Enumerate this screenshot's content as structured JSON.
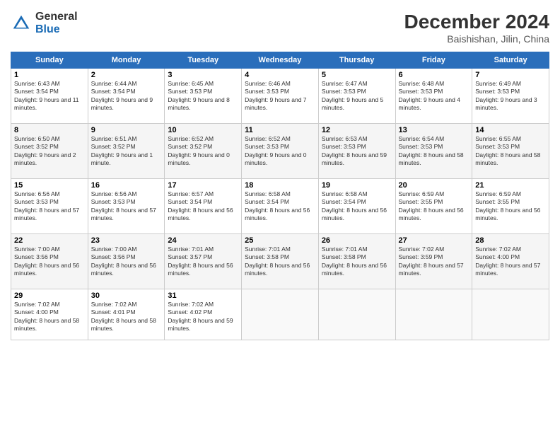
{
  "header": {
    "logo_general": "General",
    "logo_blue": "Blue",
    "month_title": "December 2024",
    "location": "Baishishan, Jilin, China"
  },
  "days_of_week": [
    "Sunday",
    "Monday",
    "Tuesday",
    "Wednesday",
    "Thursday",
    "Friday",
    "Saturday"
  ],
  "weeks": [
    [
      {
        "day": "1",
        "sunrise": "6:43 AM",
        "sunset": "3:54 PM",
        "daylight": "9 hours and 11 minutes."
      },
      {
        "day": "2",
        "sunrise": "6:44 AM",
        "sunset": "3:54 PM",
        "daylight": "9 hours and 9 minutes."
      },
      {
        "day": "3",
        "sunrise": "6:45 AM",
        "sunset": "3:53 PM",
        "daylight": "9 hours and 8 minutes."
      },
      {
        "day": "4",
        "sunrise": "6:46 AM",
        "sunset": "3:53 PM",
        "daylight": "9 hours and 7 minutes."
      },
      {
        "day": "5",
        "sunrise": "6:47 AM",
        "sunset": "3:53 PM",
        "daylight": "9 hours and 5 minutes."
      },
      {
        "day": "6",
        "sunrise": "6:48 AM",
        "sunset": "3:53 PM",
        "daylight": "9 hours and 4 minutes."
      },
      {
        "day": "7",
        "sunrise": "6:49 AM",
        "sunset": "3:53 PM",
        "daylight": "9 hours and 3 minutes."
      }
    ],
    [
      {
        "day": "8",
        "sunrise": "6:50 AM",
        "sunset": "3:52 PM",
        "daylight": "9 hours and 2 minutes."
      },
      {
        "day": "9",
        "sunrise": "6:51 AM",
        "sunset": "3:52 PM",
        "daylight": "9 hours and 1 minute."
      },
      {
        "day": "10",
        "sunrise": "6:52 AM",
        "sunset": "3:52 PM",
        "daylight": "9 hours and 0 minutes."
      },
      {
        "day": "11",
        "sunrise": "6:52 AM",
        "sunset": "3:53 PM",
        "daylight": "9 hours and 0 minutes."
      },
      {
        "day": "12",
        "sunrise": "6:53 AM",
        "sunset": "3:53 PM",
        "daylight": "8 hours and 59 minutes."
      },
      {
        "day": "13",
        "sunrise": "6:54 AM",
        "sunset": "3:53 PM",
        "daylight": "8 hours and 58 minutes."
      },
      {
        "day": "14",
        "sunrise": "6:55 AM",
        "sunset": "3:53 PM",
        "daylight": "8 hours and 58 minutes."
      }
    ],
    [
      {
        "day": "15",
        "sunrise": "6:56 AM",
        "sunset": "3:53 PM",
        "daylight": "8 hours and 57 minutes."
      },
      {
        "day": "16",
        "sunrise": "6:56 AM",
        "sunset": "3:53 PM",
        "daylight": "8 hours and 57 minutes."
      },
      {
        "day": "17",
        "sunrise": "6:57 AM",
        "sunset": "3:54 PM",
        "daylight": "8 hours and 56 minutes."
      },
      {
        "day": "18",
        "sunrise": "6:58 AM",
        "sunset": "3:54 PM",
        "daylight": "8 hours and 56 minutes."
      },
      {
        "day": "19",
        "sunrise": "6:58 AM",
        "sunset": "3:54 PM",
        "daylight": "8 hours and 56 minutes."
      },
      {
        "day": "20",
        "sunrise": "6:59 AM",
        "sunset": "3:55 PM",
        "daylight": "8 hours and 56 minutes."
      },
      {
        "day": "21",
        "sunrise": "6:59 AM",
        "sunset": "3:55 PM",
        "daylight": "8 hours and 56 minutes."
      }
    ],
    [
      {
        "day": "22",
        "sunrise": "7:00 AM",
        "sunset": "3:56 PM",
        "daylight": "8 hours and 56 minutes."
      },
      {
        "day": "23",
        "sunrise": "7:00 AM",
        "sunset": "3:56 PM",
        "daylight": "8 hours and 56 minutes."
      },
      {
        "day": "24",
        "sunrise": "7:01 AM",
        "sunset": "3:57 PM",
        "daylight": "8 hours and 56 minutes."
      },
      {
        "day": "25",
        "sunrise": "7:01 AM",
        "sunset": "3:58 PM",
        "daylight": "8 hours and 56 minutes."
      },
      {
        "day": "26",
        "sunrise": "7:01 AM",
        "sunset": "3:58 PM",
        "daylight": "8 hours and 56 minutes."
      },
      {
        "day": "27",
        "sunrise": "7:02 AM",
        "sunset": "3:59 PM",
        "daylight": "8 hours and 57 minutes."
      },
      {
        "day": "28",
        "sunrise": "7:02 AM",
        "sunset": "4:00 PM",
        "daylight": "8 hours and 57 minutes."
      }
    ],
    [
      {
        "day": "29",
        "sunrise": "7:02 AM",
        "sunset": "4:00 PM",
        "daylight": "8 hours and 58 minutes."
      },
      {
        "day": "30",
        "sunrise": "7:02 AM",
        "sunset": "4:01 PM",
        "daylight": "8 hours and 58 minutes."
      },
      {
        "day": "31",
        "sunrise": "7:02 AM",
        "sunset": "4:02 PM",
        "daylight": "8 hours and 59 minutes."
      },
      {
        "day": "",
        "sunrise": "",
        "sunset": "",
        "daylight": ""
      },
      {
        "day": "",
        "sunrise": "",
        "sunset": "",
        "daylight": ""
      },
      {
        "day": "",
        "sunrise": "",
        "sunset": "",
        "daylight": ""
      },
      {
        "day": "",
        "sunrise": "",
        "sunset": "",
        "daylight": ""
      }
    ]
  ]
}
